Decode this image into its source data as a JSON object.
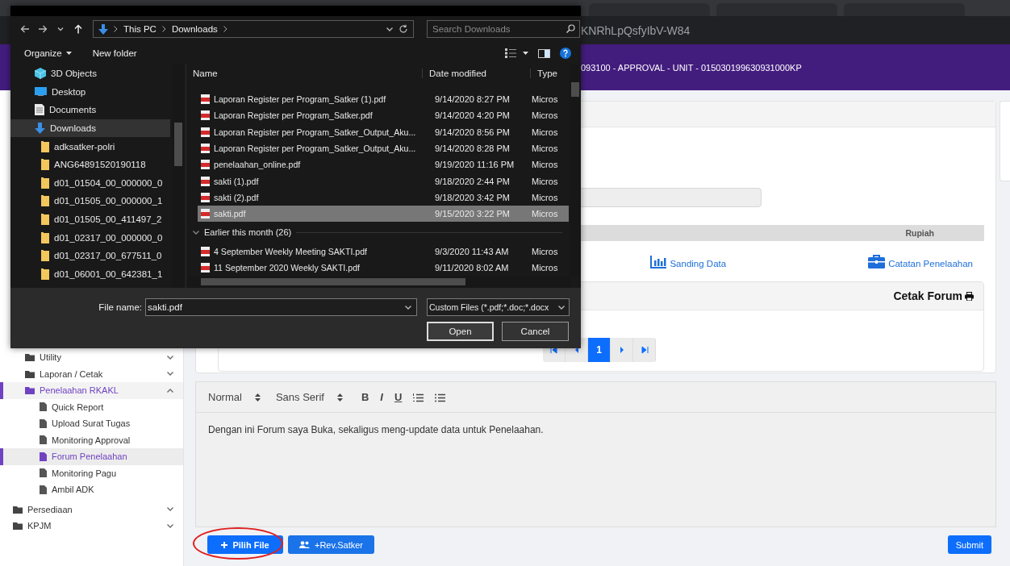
{
  "browser": {
    "url": "KNRhLpQsfyIbV-W84"
  },
  "header": {
    "title": "093100 - APPROVAL - UNIT - 015030199630931000KP"
  },
  "sidebar": {
    "items": [
      {
        "kind": "menu",
        "label": "Utility",
        "expanded": false,
        "selected": false
      },
      {
        "kind": "menu",
        "label": "Laporan / Cetak",
        "expanded": false,
        "selected": false
      },
      {
        "kind": "menu",
        "label": "Penelaahan RKAKL",
        "expanded": true,
        "selected": true,
        "children": [
          {
            "label": "Quick Report",
            "selected": false
          },
          {
            "label": "Upload Surat Tugas",
            "selected": false
          },
          {
            "label": "Monitoring Approval",
            "selected": false
          },
          {
            "label": "Forum Penelaahan",
            "selected": true
          },
          {
            "label": "Monitoring Pagu",
            "selected": false
          },
          {
            "label": "Ambil ADK",
            "selected": false
          }
        ]
      },
      {
        "kind": "module",
        "label": "Persediaan",
        "expanded": false,
        "selected": false
      },
      {
        "kind": "module",
        "label": "KPJM",
        "expanded": false,
        "selected": false
      }
    ]
  },
  "main": {
    "table": {
      "columns": [
        "Rupiah"
      ]
    },
    "links": [
      {
        "kind": "chart",
        "label": "Sanding Data"
      },
      {
        "kind": "briefcase",
        "label": "Catatan Penelaahan"
      }
    ],
    "forum_panel": {
      "title": "Cetak Forum",
      "pagination": [
        {
          "kind": "first"
        },
        {
          "kind": "prev"
        },
        {
          "kind": "page",
          "label": "1",
          "selected": true
        },
        {
          "kind": "next"
        },
        {
          "kind": "last"
        }
      ]
    },
    "editor": {
      "format": "Normal",
      "font": "Sans Serif",
      "tools": [
        {
          "kind": "bold",
          "label": "B"
        },
        {
          "kind": "italic",
          "label": "I"
        },
        {
          "kind": "underline",
          "label": "U"
        },
        {
          "kind": "ordered-list"
        },
        {
          "kind": "bullet-list"
        }
      ],
      "text": "Dengan ini Forum saya Buka, sekaligus meng-update data untuk Penelaahan."
    },
    "actions": [
      {
        "kind": "add-file",
        "label": "Pilih File",
        "circled": true
      },
      {
        "kind": "users",
        "label": "+Rev.Satker",
        "circled": false
      },
      {
        "kind": "submit",
        "label": "Submit",
        "circled": false
      }
    ]
  },
  "dialog": {
    "path": [
      "This PC",
      "Downloads"
    ],
    "search": {
      "placeholder": "Search Downloads"
    },
    "commands": [
      {
        "kind": "menu",
        "label": "Organize"
      },
      {
        "kind": "button",
        "label": "New folder"
      }
    ],
    "nav": [
      {
        "kind": "objects",
        "label": "3D Objects",
        "selected": false
      },
      {
        "kind": "desktop",
        "label": "Desktop",
        "selected": false
      },
      {
        "kind": "documents",
        "label": "Documents",
        "selected": false
      },
      {
        "kind": "downloads",
        "label": "Downloads",
        "selected": true
      },
      {
        "kind": "folder",
        "label": "adksatker-polri",
        "selected": false
      },
      {
        "kind": "folder",
        "label": "ANG64891520190118",
        "selected": false
      },
      {
        "kind": "folder",
        "label": "d01_01504_00_000000_0",
        "selected": false
      },
      {
        "kind": "folder",
        "label": "d01_01505_00_000000_1",
        "selected": false
      },
      {
        "kind": "folder",
        "label": "d01_01505_00_411497_2",
        "selected": false
      },
      {
        "kind": "folder",
        "label": "d01_02317_00_000000_0",
        "selected": false
      },
      {
        "kind": "folder",
        "label": "d01_02317_00_677511_0",
        "selected": false
      },
      {
        "kind": "folder",
        "label": "d01_06001_00_642381_1",
        "selected": false
      }
    ],
    "columns": [
      "Name",
      "Date modified",
      "Type"
    ],
    "files": [
      {
        "kind": "file",
        "name": "Laporan Register per Program_Satker (1).pdf",
        "date": "9/14/2020 8:27 PM",
        "type": "Micros",
        "selected": false
      },
      {
        "kind": "file",
        "name": "Laporan Register per Program_Satker.pdf",
        "date": "9/14/2020 4:20 PM",
        "type": "Micros",
        "selected": false
      },
      {
        "kind": "file",
        "name": "Laporan Register per Program_Satker_Output_Aku...",
        "date": "9/14/2020 8:56 PM",
        "type": "Micros",
        "selected": false
      },
      {
        "kind": "file",
        "name": "Laporan Register per Program_Satker_Output_Aku...",
        "date": "9/14/2020 8:28 PM",
        "type": "Micros",
        "selected": false
      },
      {
        "kind": "file",
        "name": "penelaahan_online.pdf",
        "date": "9/19/2020 11:16 PM",
        "type": "Micros",
        "selected": false
      },
      {
        "kind": "file",
        "name": "sakti (1).pdf",
        "date": "9/18/2020 2:44 PM",
        "type": "Micros",
        "selected": false
      },
      {
        "kind": "file",
        "name": "sakti (2).pdf",
        "date": "9/18/2020 3:42 PM",
        "type": "Micros",
        "selected": false
      },
      {
        "kind": "file",
        "name": "sakti.pdf",
        "date": "9/15/2020 3:22 PM",
        "type": "Micros",
        "selected": true
      },
      {
        "kind": "group",
        "name": "Earlier this month (26)"
      },
      {
        "kind": "file",
        "name": "4 September Weekly Meeting SAKTI.pdf",
        "date": "9/3/2020 11:43 AM",
        "type": "Micros",
        "selected": false
      },
      {
        "kind": "file",
        "name": "11 September 2020 Weekly SAKTI.pdf",
        "date": "9/11/2020 8:02 AM",
        "type": "Micros",
        "selected": false
      }
    ],
    "file_name": {
      "label": "File name:",
      "value": "sakti.pdf"
    },
    "filter": "Custom Files (*.pdf;*.doc;*.docx",
    "buttons": [
      {
        "label": "Open",
        "focused": true
      },
      {
        "label": "Cancel",
        "focused": false
      }
    ]
  }
}
